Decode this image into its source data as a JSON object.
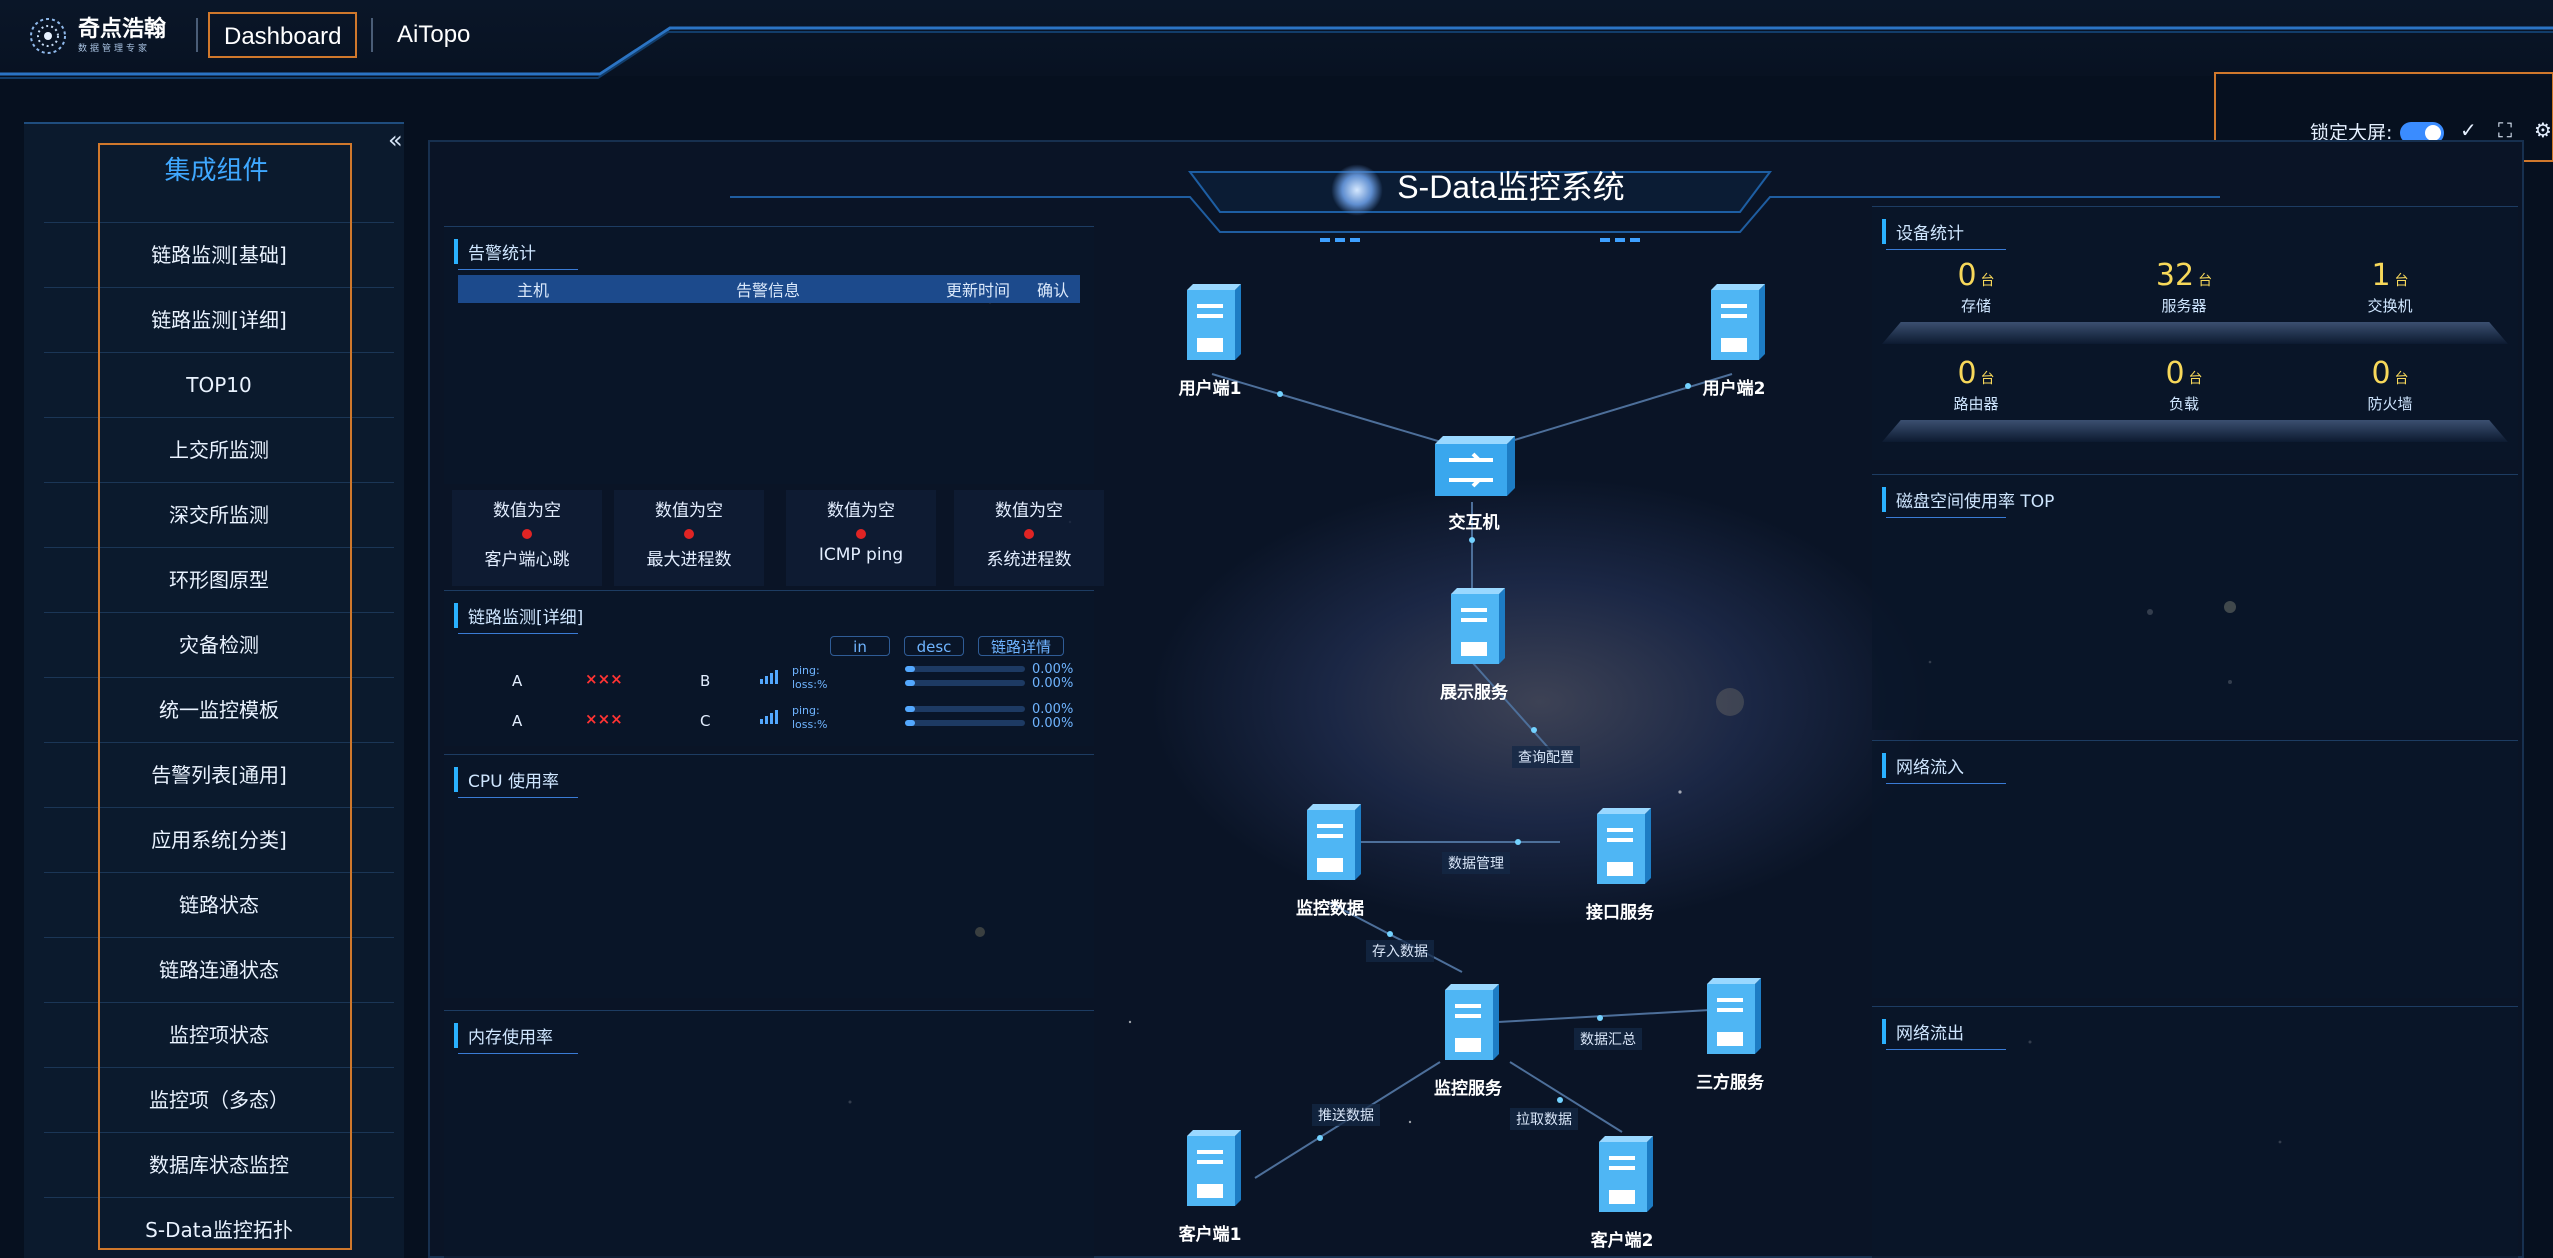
{
  "app": {
    "logo_title": "奇点浩翰",
    "logo_sub": "数据管理专家",
    "nav": [
      "Dashboard",
      "AiTopo"
    ]
  },
  "lock": {
    "label": "锁定大屏:",
    "enabled": true
  },
  "sidebar": {
    "title": "集成组件",
    "items": [
      "链路监测[基础]",
      "链路监测[详细]",
      "TOP10",
      "上交所监测",
      "深交所监测",
      "环形图原型",
      "灾备检测",
      "统一监控模板",
      "告警列表[通用]",
      "应用系统[分类]",
      "链路状态",
      "链路连通状态",
      "监控项状态",
      "监控项（多态）",
      "数据库状态监控",
      "S-Data监控拓扑"
    ]
  },
  "dashboard": {
    "title": "S-Data监控系统",
    "alarm": {
      "title": "告警统计",
      "columns": [
        "主机",
        "告警信息",
        "更新时间",
        "确认"
      ]
    },
    "status_cards": [
      {
        "value": "数值为空",
        "label": "客户端心跳"
      },
      {
        "value": "数值为空",
        "label": "最大进程数"
      },
      {
        "value": "数值为空",
        "label": "ICMP ping"
      },
      {
        "value": "数值为空",
        "label": "系统进程数"
      }
    ],
    "link_detail": {
      "title": "链路监测[详细]",
      "tags": [
        "in",
        "desc",
        "链路详情"
      ],
      "rows": [
        {
          "from": "A",
          "status": "×××",
          "to": "B",
          "ping": "ping:",
          "loss": "loss:%",
          "ping_pct": "0.00%",
          "loss_pct": "0.00%"
        },
        {
          "from": "A",
          "status": "×××",
          "to": "C",
          "ping": "ping:",
          "loss": "loss:%",
          "ping_pct": "0.00%",
          "loss_pct": "0.00%"
        }
      ]
    },
    "cpu": {
      "title": "CPU 使用率"
    },
    "memory": {
      "title": "内存使用率"
    },
    "devices": {
      "title": "设备统计",
      "unit": "台",
      "items": [
        {
          "num": "0",
          "label": "存储"
        },
        {
          "num": "32",
          "label": "服务器"
        },
        {
          "num": "1",
          "label": "交换机"
        },
        {
          "num": "0",
          "label": "路由器"
        },
        {
          "num": "0",
          "label": "负载"
        },
        {
          "num": "0",
          "label": "防火墙"
        }
      ]
    },
    "disk": {
      "title": "磁盘空间使用率 TOP"
    },
    "net_in": {
      "title": "网络流入"
    },
    "net_out": {
      "title": "网络流出"
    },
    "topology": {
      "nodes": [
        "用户端1",
        "用户端2",
        "交互机",
        "展示服务",
        "监控数据",
        "接口服务",
        "监控服务",
        "三方服务",
        "客户端1",
        "客户端2"
      ],
      "edges": [
        "查询配置",
        "数据管理",
        "存入数据",
        "数据汇总",
        "推送数据",
        "拉取数据"
      ]
    }
  }
}
